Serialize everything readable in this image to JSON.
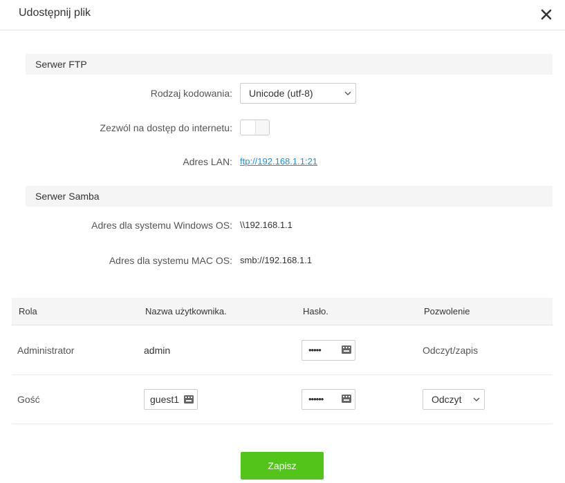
{
  "dialog": {
    "title": "Udostępnij plik"
  },
  "ftp": {
    "section_title": "Serwer FTP",
    "encoding_label": "Rodzaj kodowania:",
    "encoding_value": "Unicode (utf-8)",
    "internet_label": "Zezwól na dostęp do internetu:",
    "internet_enabled": false,
    "lan_label": "Adres LAN:",
    "lan_value": "ftp://192.168.1.1:21"
  },
  "samba": {
    "section_title": "Serwer Samba",
    "windows_label": "Adres dla systemu Windows OS:",
    "windows_value": "\\\\192.168.1.1",
    "mac_label": "Adres dla systemu MAC OS:",
    "mac_value": "smb://192.168.1.1"
  },
  "table": {
    "headers": [
      "Rola",
      "Nazwa użytkownika.",
      "Hasło.",
      "Pozwolenie"
    ],
    "rows": [
      {
        "role": "Administrator",
        "username": "admin",
        "password_mask": "•••••",
        "permission": "Odczyt/zapis"
      },
      {
        "role": "Gość",
        "username": "guest1",
        "password_mask": "••••••",
        "permission": "Odczyt"
      }
    ]
  },
  "actions": {
    "save_label": "Zapisz"
  },
  "colors": {
    "accent_green": "#52c41a",
    "link_blue": "#1a8fe3"
  },
  "icons": {
    "close": "close-icon",
    "dropdown": "chevron-down-icon",
    "keyboard": "keyboard-icon"
  }
}
